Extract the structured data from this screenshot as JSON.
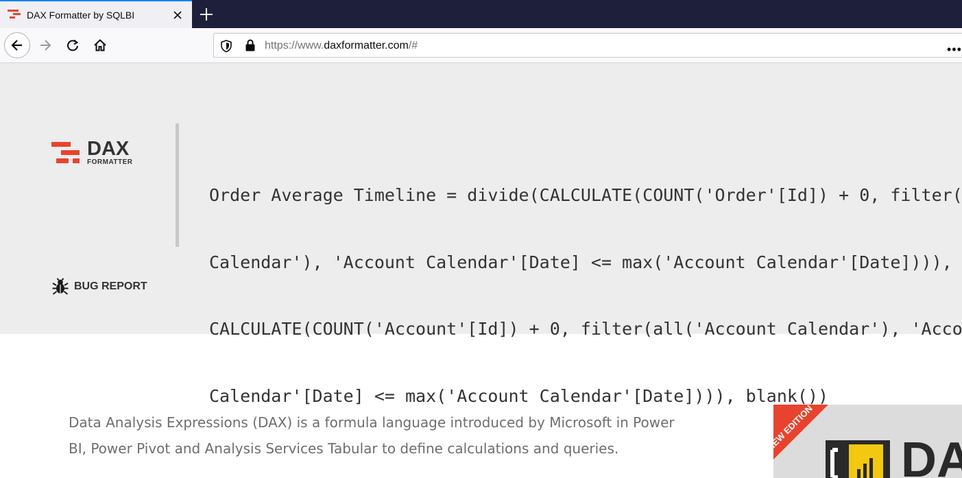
{
  "browser": {
    "tab": {
      "title": "DAX Formatter by SQLBI"
    },
    "url": {
      "prefix": "https://www.",
      "domain": "daxformatter.com",
      "suffix": "/#"
    }
  },
  "hero": {
    "logo": {
      "title": "DAX",
      "subtitle": "FORMATTER"
    },
    "code_lines": [
      "Order Average Timeline = divide(CALCULATE(COUNT('Order'[Id]) + 0, filter(all('Account",
      "Calendar'), 'Account Calendar'[Date] <= max('Account Calendar'[Date]))),",
      "CALCULATE(COUNT('Account'[Id]) + 0, filter(all('Account Calendar'), 'Account",
      "Calendar'[Date] <= max('Account Calendar'[Date]))), blank())"
    ],
    "bug_report": "BUG REPORT"
  },
  "content": {
    "description": "Data Analysis Expressions (DAX) is a formula language introduced by Microsoft in Power BI, Power Pivot and Analysis Services Tabular to define calculations and queries.",
    "book": {
      "ribbon": "NEW EDITION",
      "title": "DA"
    }
  },
  "colors": {
    "accent_red": "#e8432e",
    "hero_bg": "#ededed",
    "code_text": "#333333",
    "desc_text": "#6e6e6e"
  }
}
